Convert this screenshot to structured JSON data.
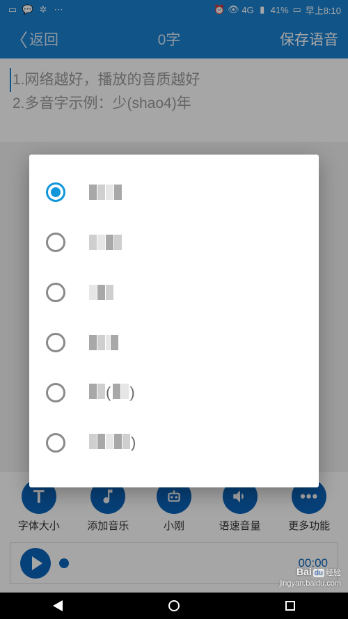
{
  "status": {
    "battery": "41%",
    "net": "4G",
    "clock": "早上8:10"
  },
  "header": {
    "back": "返回",
    "title": "0字",
    "save": "保存语音"
  },
  "editor": {
    "line1": "1.网络越好，播放的音质越好",
    "line2": "2.多音字示例：少(shao4)年"
  },
  "voice_options": {
    "selected_index": 0,
    "visible_labels": [
      "小X",
      "",
      "",
      "小丫",
      "X(XX)",
      "女XX"
    ]
  },
  "toolbar": {
    "font_size": {
      "label": "字体大小",
      "icon": "T"
    },
    "add_music": {
      "label": "添加音乐"
    },
    "voice": {
      "label": "小刚"
    },
    "speed": {
      "label": "语速音量"
    },
    "more": {
      "label": "更多功能",
      "icon": "•••"
    }
  },
  "player": {
    "time": "00:00"
  },
  "watermark": {
    "brand": "Bai",
    "brand2": "du",
    "text": "经验",
    "url": "jingyan.baidu.com"
  }
}
